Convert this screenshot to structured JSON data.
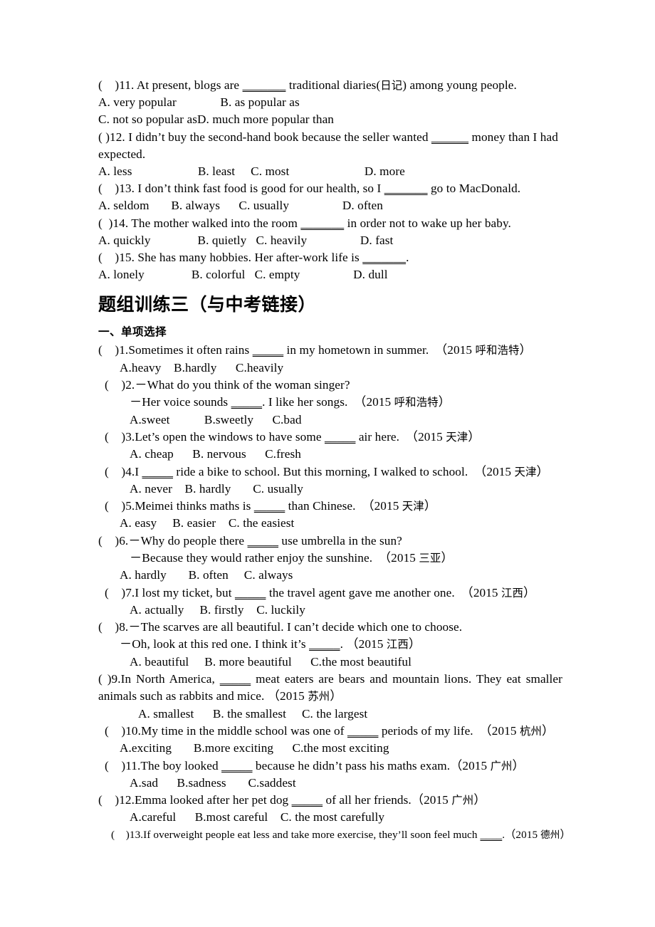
{
  "top_block": {
    "q11": {
      "stem": "(    )11. At present, blogs are ",
      "blank": "_______",
      "stem_tail": " traditional diaries(",
      "gloss": "日记",
      "stem_tail2": ") among young people.",
      "options_line1": "A. very popular              B. as popular as",
      "options_line2": "C. not so popular asD. much more popular than"
    },
    "q12": {
      "stem": "(    )12. I didn’t buy the second-hand book because the seller wanted ",
      "blank": "______",
      "stem_tail": " money than I had",
      "continuation": "expected.",
      "options_line1": "A. less                     B. least     C. most                        D. more"
    },
    "q13": {
      "stem": "(    )13. I don’t think fast food is good for our health, so I ",
      "blank": "_______",
      "stem_tail": " go to MacDonald.",
      "options_line1": "A. seldom       B. always      C. usually                 D. often"
    },
    "q14": {
      "stem": "(  )14. The mother walked into the room ",
      "blank": "_______",
      "stem_tail": " in order not to wake up her baby.",
      "options_line1": "A. quickly               B. quietly   C. heavily                 D. fast"
    },
    "q15": {
      "stem": "(    )15. She has many hobbies. Her after-work life is ",
      "blank": "_______",
      "stem_tail": ".",
      "options_line1": "A. lonely               B. colorful   C. empty                 D. dull"
    }
  },
  "section": {
    "title": "题组训练三（与中考链接）",
    "subtitle": "一、单项选择"
  },
  "questions": [
    {
      "id": "1",
      "lines": [
        {
          "indent": "i0",
          "parts": [
            {
              "t": "(    )1.Sometimes it often rains "
            },
            {
              "t": "_____",
              "u": true
            },
            {
              "t": " in my hometown in summer.  （2015 "
            },
            {
              "t": "呼和浩特",
              "cn": true
            },
            {
              "t": "）"
            }
          ]
        },
        {
          "indent": "i3",
          "parts": [
            {
              "t": "A.heavy    B.hardly      C.heavily"
            }
          ]
        }
      ]
    },
    {
      "id": "2",
      "lines": [
        {
          "indent": "i1",
          "parts": [
            {
              "t": "(    )2.－What do you think of the woman singer?"
            }
          ]
        },
        {
          "indent": "i4",
          "parts": [
            {
              "t": "－Her voice sounds "
            },
            {
              "t": "_____",
              "u": true
            },
            {
              "t": ". I like her songs.  （2015 "
            },
            {
              "t": "呼和浩特",
              "cn": true
            },
            {
              "t": "）"
            }
          ]
        },
        {
          "indent": "i4",
          "parts": [
            {
              "t": "A.sweet           B.sweetly      C.bad"
            }
          ]
        }
      ]
    },
    {
      "id": "3",
      "lines": [
        {
          "indent": "i1",
          "parts": [
            {
              "t": "(    )3.Let’s open the windows to have some "
            },
            {
              "t": "_____",
              "u": true
            },
            {
              "t": " air here.  （2015 "
            },
            {
              "t": "天津",
              "cn": true
            },
            {
              "t": "）"
            }
          ]
        },
        {
          "indent": "i4",
          "parts": [
            {
              "t": "A. cheap      B. nervous      C.fresh"
            }
          ]
        }
      ]
    },
    {
      "id": "4",
      "lines": [
        {
          "indent": "i1",
          "parts": [
            {
              "t": "(    )4.I "
            },
            {
              "t": "_____",
              "u": true
            },
            {
              "t": " ride a bike to school. But this morning, I walked to school.  （2015 "
            },
            {
              "t": "天津",
              "cn": true
            },
            {
              "t": "）"
            }
          ]
        },
        {
          "indent": "i4",
          "parts": [
            {
              "t": "A. never    B. hardly       C. usually"
            }
          ]
        }
      ]
    },
    {
      "id": "5",
      "lines": [
        {
          "indent": "i1",
          "parts": [
            {
              "t": "(    )5.Meimei thinks maths is "
            },
            {
              "t": "_____",
              "u": true
            },
            {
              "t": " than Chinese.  （2015 "
            },
            {
              "t": "天津",
              "cn": true
            },
            {
              "t": "）"
            }
          ]
        },
        {
          "indent": "i3",
          "parts": [
            {
              "t": "A. easy     B. easier    C. the easiest"
            }
          ]
        }
      ]
    },
    {
      "id": "6",
      "lines": [
        {
          "indent": "i0",
          "parts": [
            {
              "t": "(    )6.－Why do people there "
            },
            {
              "t": "_____",
              "u": true
            },
            {
              "t": " use umbrella in the sun?"
            }
          ]
        },
        {
          "indent": "i4",
          "parts": [
            {
              "t": "－Because they would rather enjoy the sunshine.  （2015 "
            },
            {
              "t": "三亚",
              "cn": true
            },
            {
              "t": "）"
            }
          ]
        },
        {
          "indent": "i3",
          "parts": [
            {
              "t": "A. hardly       B. often     C. always"
            }
          ]
        }
      ]
    },
    {
      "id": "7",
      "lines": [
        {
          "indent": "i1",
          "parts": [
            {
              "t": "(    )7.I lost my ticket, but "
            },
            {
              "t": "_____",
              "u": true
            },
            {
              "t": " the travel agent gave me another one.  （2015 "
            },
            {
              "t": "江西",
              "cn": true
            },
            {
              "t": "）"
            }
          ]
        },
        {
          "indent": "i4",
          "parts": [
            {
              "t": "A. actually     B. firstly    C. luckily"
            }
          ]
        }
      ]
    },
    {
      "id": "8",
      "lines": [
        {
          "indent": "i0",
          "parts": [
            {
              "t": "(    )8.－The scarves are all beautiful. I can’t decide which one to choose."
            }
          ]
        },
        {
          "indent": "i3",
          "parts": [
            {
              "t": "－Oh, look at this red one. I think it’s "
            },
            {
              "t": "_____",
              "u": true
            },
            {
              "t": ". （2015 "
            },
            {
              "t": "江西",
              "cn": true
            },
            {
              "t": "）"
            }
          ]
        },
        {
          "indent": "i4",
          "parts": [
            {
              "t": "A. beautiful     B. more beautiful      C.the most beautiful"
            }
          ]
        }
      ]
    },
    {
      "id": "9",
      "lines": [
        {
          "indent": "i0",
          "justify": true,
          "parts": [
            {
              "t": "(      )9.In North America, "
            },
            {
              "t": "_____",
              "u": true
            },
            {
              "t": " meat eaters are bears and mountain lions. They eat smaller animals such as rabbits and mice.  （2015 "
            },
            {
              "t": "苏州",
              "cn": true
            },
            {
              "t": "）"
            }
          ]
        },
        {
          "indent": "i5",
          "parts": [
            {
              "t": "A. smallest      B. the smallest     C. the largest"
            }
          ]
        }
      ]
    },
    {
      "id": "10",
      "lines": [
        {
          "indent": "i1",
          "parts": [
            {
              "t": "(    )10.My time in the middle school was one of "
            },
            {
              "t": "_____",
              "u": true
            },
            {
              "t": " periods of my life.  （2015 "
            },
            {
              "t": "杭州",
              "cn": true
            },
            {
              "t": "）"
            }
          ]
        },
        {
          "indent": "i3",
          "parts": [
            {
              "t": "A.exciting       B.more exciting      C.the most exciting"
            }
          ]
        }
      ]
    },
    {
      "id": "11",
      "lines": [
        {
          "indent": "i1",
          "parts": [
            {
              "t": "(    )11.The boy looked "
            },
            {
              "t": "_____",
              "u": true
            },
            {
              "t": " because he didn’t pass his maths exam.（2015 "
            },
            {
              "t": "广州",
              "cn": true
            },
            {
              "t": "）"
            }
          ]
        },
        {
          "indent": "i4",
          "parts": [
            {
              "t": "A.sad      B.sadness       C.saddest"
            }
          ]
        }
      ]
    },
    {
      "id": "12",
      "lines": [
        {
          "indent": "i0",
          "parts": [
            {
              "t": "(    )12.Emma looked after her pet dog "
            },
            {
              "t": "_____",
              "u": true
            },
            {
              "t": " of all her friends.（2015 "
            },
            {
              "t": "广州",
              "cn": true
            },
            {
              "t": "）"
            }
          ]
        },
        {
          "indent": "i4",
          "parts": [
            {
              "t": "A.careful      B.most careful    C. the most carefully"
            }
          ]
        }
      ]
    },
    {
      "id": "13",
      "small": true,
      "lines": [
        {
          "indent": "i2",
          "small": true,
          "parts": [
            {
              "t": "(    )13.If overweight people eat less and take more exercise, they’ll soon feel much "
            },
            {
              "t": "____",
              "u": true
            },
            {
              "t": ".（2015 "
            },
            {
              "t": "德州",
              "cn_sm": true
            },
            {
              "t": "）"
            }
          ]
        }
      ]
    }
  ]
}
